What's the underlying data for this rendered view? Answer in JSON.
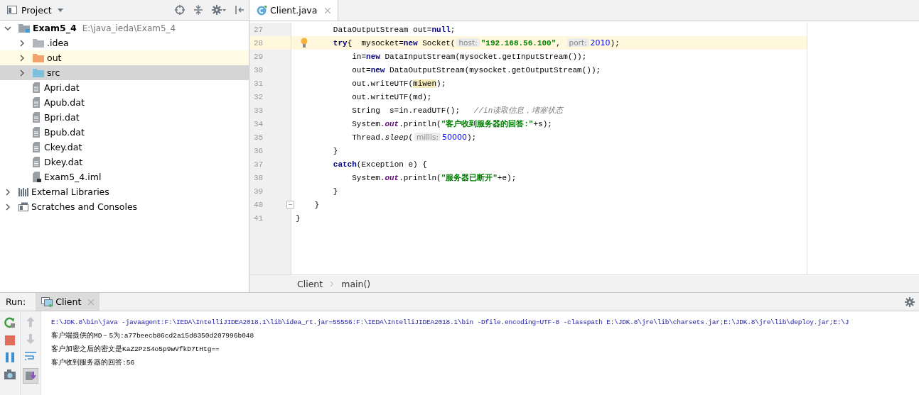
{
  "project_panel": {
    "title": "Project",
    "tree": [
      {
        "name": "Exam5_4",
        "path": "E:\\java_ieda\\Exam5_4",
        "kind": "module",
        "expanded": true,
        "selected": false,
        "children": [
          {
            "name": ".idea",
            "kind": "folder-gray",
            "expanded": false,
            "selected": false
          },
          {
            "name": "out",
            "kind": "folder-orange",
            "expanded": false,
            "selected": false
          },
          {
            "name": "src",
            "kind": "folder-blue",
            "expanded": false,
            "selected": true
          },
          {
            "name": "Apri.dat",
            "kind": "file",
            "selected": false
          },
          {
            "name": "Apub.dat",
            "kind": "file",
            "selected": false
          },
          {
            "name": "Bpri.dat",
            "kind": "file",
            "selected": false
          },
          {
            "name": "Bpub.dat",
            "kind": "file",
            "selected": false
          },
          {
            "name": "Ckey.dat",
            "kind": "file",
            "selected": false
          },
          {
            "name": "Dkey.dat",
            "kind": "file",
            "selected": false
          },
          {
            "name": "Exam5_4.iml",
            "kind": "module-file",
            "selected": false
          }
        ]
      },
      {
        "name": "External Libraries",
        "kind": "library",
        "expanded": false,
        "selected": false
      },
      {
        "name": "Scratches and Consoles",
        "kind": "scratches",
        "expanded": false,
        "selected": false
      }
    ]
  },
  "editor": {
    "tabs": [
      {
        "label": "Client.java",
        "selected": true
      }
    ],
    "lines": [
      {
        "number": "27",
        "current": false,
        "fold": false,
        "tokens": [
          {
            "text": "        DataOutputStream out=",
            "kind": "plain"
          },
          {
            "text": "null",
            "kind": "keyword"
          },
          {
            "text": ";",
            "kind": "plain"
          }
        ]
      },
      {
        "number": "28",
        "current": true,
        "fold": false,
        "tokens": [
          {
            "text": "        try",
            "kind": "keyword"
          },
          {
            "text": "{  mysocket=",
            "kind": "plain"
          },
          {
            "text": "new",
            "kind": "keyword"
          },
          {
            "text": " Socket(",
            "kind": "plain"
          },
          {
            "text": "host:",
            "kind": "hint"
          },
          {
            "text": "\"192.168.56.100\"",
            "kind": "string"
          },
          {
            "text": ", ",
            "kind": "plain"
          },
          {
            "text": "port:",
            "kind": "hint"
          },
          {
            "text": "2010",
            "kind": "number"
          },
          {
            "text": ");",
            "kind": "plain"
          }
        ]
      },
      {
        "number": "29",
        "current": false,
        "fold": false,
        "tokens": [
          {
            "text": "            in=",
            "kind": "plain"
          },
          {
            "text": "new",
            "kind": "keyword"
          },
          {
            "text": " DataInputStream(mysocket.getInputStream());",
            "kind": "plain"
          }
        ]
      },
      {
        "number": "30",
        "current": false,
        "fold": false,
        "tokens": [
          {
            "text": "            out=",
            "kind": "plain"
          },
          {
            "text": "new",
            "kind": "keyword"
          },
          {
            "text": " DataOutputStream(mysocket.getOutputStream());",
            "kind": "plain"
          }
        ]
      },
      {
        "number": "31",
        "current": false,
        "fold": false,
        "tokens": [
          {
            "text": "            out.writeUTF(",
            "kind": "plain"
          },
          {
            "text": "miwen",
            "kind": "highlight"
          },
          {
            "text": ");",
            "kind": "plain"
          }
        ]
      },
      {
        "number": "32",
        "current": false,
        "fold": false,
        "tokens": [
          {
            "text": "            out.writeUTF(md);",
            "kind": "plain"
          }
        ]
      },
      {
        "number": "33",
        "current": false,
        "fold": false,
        "tokens": [
          {
            "text": "            String  s=in.readUTF();   ",
            "kind": "plain"
          },
          {
            "text": "//in读取信息，堵塞状态",
            "kind": "comment"
          }
        ]
      },
      {
        "number": "34",
        "current": false,
        "fold": false,
        "tokens": [
          {
            "text": "            System.",
            "kind": "plain"
          },
          {
            "text": "out",
            "kind": "field"
          },
          {
            "text": ".println(",
            "kind": "plain"
          },
          {
            "text": "\"客户收到服务器的回答:\"",
            "kind": "string"
          },
          {
            "text": "+s);",
            "kind": "plain"
          }
        ]
      },
      {
        "number": "35",
        "current": false,
        "fold": false,
        "tokens": [
          {
            "text": "            Thread.",
            "kind": "plain"
          },
          {
            "text": "sleep",
            "kind": "static"
          },
          {
            "text": "(",
            "kind": "plain"
          },
          {
            "text": "millis:",
            "kind": "hint"
          },
          {
            "text": "50000",
            "kind": "number"
          },
          {
            "text": ");",
            "kind": "plain"
          }
        ]
      },
      {
        "number": "36",
        "current": false,
        "fold": false,
        "tokens": [
          {
            "text": "        }",
            "kind": "plain"
          }
        ]
      },
      {
        "number": "37",
        "current": false,
        "fold": false,
        "tokens": [
          {
            "text": "        catch",
            "kind": "keyword"
          },
          {
            "text": "(Exception e) {",
            "kind": "plain"
          }
        ]
      },
      {
        "number": "38",
        "current": false,
        "fold": false,
        "tokens": [
          {
            "text": "            System.",
            "kind": "plain"
          },
          {
            "text": "out",
            "kind": "field"
          },
          {
            "text": ".println(",
            "kind": "plain"
          },
          {
            "text": "\"服务器已断开\"",
            "kind": "string"
          },
          {
            "text": "+e);",
            "kind": "plain"
          }
        ]
      },
      {
        "number": "39",
        "current": false,
        "fold": false,
        "tokens": [
          {
            "text": "        }",
            "kind": "plain"
          }
        ]
      },
      {
        "number": "40",
        "current": false,
        "fold": true,
        "tokens": [
          {
            "text": "    }",
            "kind": "plain"
          }
        ]
      },
      {
        "number": "41",
        "current": false,
        "fold": false,
        "tokens": [
          {
            "text": "}",
            "kind": "plain"
          }
        ]
      }
    ],
    "breadcrumbs": [
      "Client",
      "main()"
    ]
  },
  "run_panel": {
    "label": "Run:",
    "tabs": [
      {
        "label": "Client",
        "selected": true
      }
    ],
    "console": [
      {
        "text": "E:\\JDK.8\\bin\\java -javaagent:F:\\IEDA\\IntelliJIDEA2018.1\\lib\\idea_rt.jar=55556:F:\\IEDA\\IntelliJIDEA2018.1\\bin -Dfile.encoding=UTF-8 -classpath E:\\JDK.8\\jre\\lib\\charsets.jar;E:\\JDK.8\\jre\\lib\\deploy.jar;E:\\J",
        "kind": "command"
      },
      {
        "text": "客户端提供的MD－5为:a77beecb86cd2a15d8350d207996b048",
        "kind": "output"
      },
      {
        "text": "客户加密之后的密文是KaZ2PzS4o5p9wVfkD7tHtg==",
        "kind": "output"
      },
      {
        "text": "客户收到服务器的回答:56",
        "kind": "output"
      }
    ]
  }
}
